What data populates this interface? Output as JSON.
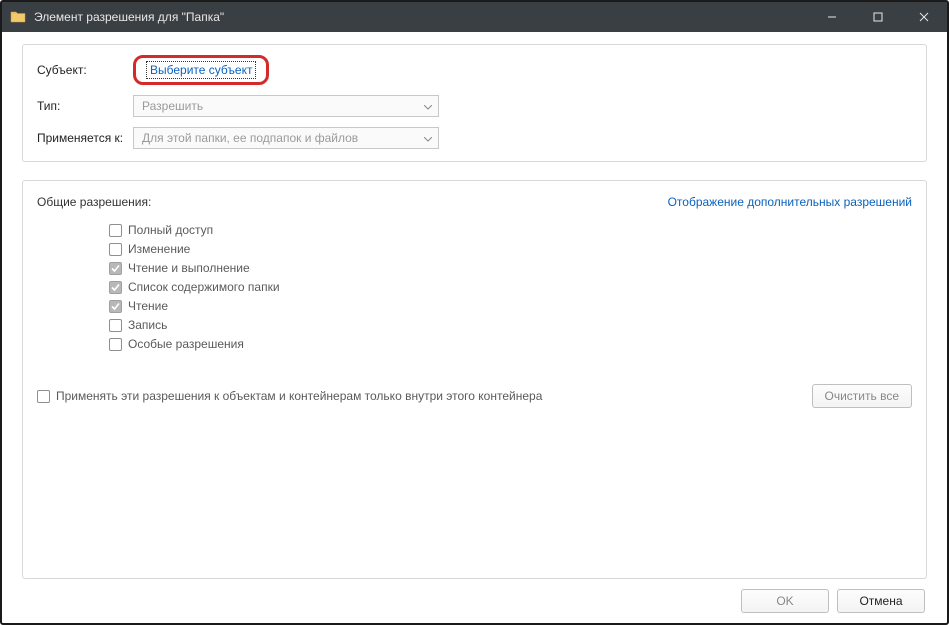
{
  "window": {
    "title": "Элемент разрешения для \"Папка\""
  },
  "form": {
    "subject_label": "Субъект:",
    "subject_link": "Выберите субъект",
    "type_label": "Тип:",
    "type_value": "Разрешить",
    "applies_label": "Применяется к:",
    "applies_value": "Для этой папки, ее подпапок и файлов"
  },
  "permissions": {
    "title": "Общие разрешения:",
    "advanced_link": "Отображение дополнительных разрешений",
    "items": [
      {
        "label": "Полный доступ",
        "checked": false
      },
      {
        "label": "Изменение",
        "checked": false
      },
      {
        "label": "Чтение и выполнение",
        "checked": true
      },
      {
        "label": "Список содержимого папки",
        "checked": true
      },
      {
        "label": "Чтение",
        "checked": true
      },
      {
        "label": "Запись",
        "checked": false
      },
      {
        "label": "Особые разрешения",
        "checked": false
      }
    ],
    "only_container_label": "Применять эти разрешения к объектам и контейнерам только внутри этого контейнера",
    "clear_button": "Очистить все"
  },
  "footer": {
    "ok": "OK",
    "cancel": "Отмена"
  }
}
